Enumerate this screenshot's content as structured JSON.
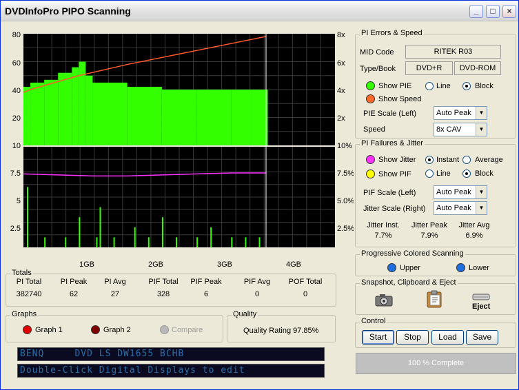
{
  "window": {
    "title": "DVDInfoPro PIPO Scanning",
    "buttons": {
      "minimize": "_",
      "maximize": "□",
      "close": "×"
    }
  },
  "chart_data": [
    {
      "type": "bar",
      "panel": "pi-errors",
      "yleft_ticks": [
        "80",
        "60",
        "40",
        "20",
        "10"
      ],
      "yright_ticks": [
        "8x",
        "6x",
        "4x",
        "2x"
      ],
      "ylim": [
        0,
        80
      ],
      "series": [
        {
          "name": "PIE",
          "kind": "bar",
          "color": "#33ff00",
          "x": [
            0.0,
            0.1,
            0.3,
            0.5,
            0.7,
            0.8,
            0.9,
            1.0,
            1.5,
            2.0,
            2.5,
            3.0,
            3.3,
            3.5
          ],
          "values": [
            42,
            45,
            47,
            52,
            56,
            60,
            50,
            45,
            42,
            40,
            40,
            40,
            40,
            40
          ]
        },
        {
          "name": "Speed",
          "kind": "line",
          "color": "#ff5a2a",
          "x": [
            0.0,
            0.1,
            0.8,
            1.5,
            2.5,
            3.5
          ],
          "values": [
            38,
            40,
            50,
            58,
            68,
            78
          ]
        }
      ],
      "xlim": [
        0,
        4.5
      ]
    },
    {
      "type": "bar",
      "panel": "pi-failures",
      "yleft_ticks": [
        "7.5",
        "5",
        "2.5"
      ],
      "yright_ticks": [
        "10%",
        "7.5%",
        "5.0%",
        "2.5%"
      ],
      "ylim": [
        0,
        10
      ],
      "series": [
        {
          "name": "Jitter",
          "kind": "line",
          "color": "#ff33ff",
          "x": [
            0.0,
            0.5,
            1.0,
            1.5,
            2.0,
            2.5,
            3.0,
            3.5
          ],
          "values": [
            7.3,
            7.2,
            7.1,
            7.1,
            7.2,
            7.3,
            7.4,
            7.4
          ]
        },
        {
          "name": "PIF",
          "kind": "bar",
          "color": "#33ff00",
          "x": [
            0.05,
            0.3,
            0.6,
            0.8,
            1.05,
            1.1,
            1.3,
            1.6,
            1.8,
            2.0,
            2.2,
            2.5,
            2.7,
            3.0,
            3.2,
            3.4
          ],
          "values": [
            6,
            1,
            1,
            3,
            1,
            4,
            1,
            2,
            1,
            3,
            1,
            1,
            2,
            1,
            1,
            1
          ]
        }
      ],
      "xlim": [
        0,
        4.5
      ]
    }
  ],
  "chart_x_ticks": [
    "1GB",
    "2GB",
    "3GB",
    "4GB"
  ],
  "totals": {
    "label": "Totals",
    "headers": [
      "PI Total",
      "PI Peak",
      "PI Avg",
      "PIF Total",
      "PIF Peak",
      "PIF Avg",
      "POF Total"
    ],
    "values": [
      "382740",
      "62",
      "27",
      "328",
      "6",
      "0",
      "0"
    ]
  },
  "graphs": {
    "label": "Graphs",
    "graph1": "Graph 1",
    "graph2": "Graph 2",
    "compare": "Compare"
  },
  "quality": {
    "label": "Quality",
    "text": "Quality Rating 97.85%"
  },
  "lcd": {
    "line1": "BENQ     DVD LS DW1655 BCHB",
    "line2": "Double-Click Digital Displays to edit"
  },
  "pi_errors": {
    "label": "PI Errors & Speed",
    "mid_code_label": "MID Code",
    "mid_code_value": "RITEK   R03",
    "type_label": "Type/Book",
    "type_value": "DVD+R",
    "book_value": "DVD-ROM",
    "show_pie": "Show PIE",
    "show_speed": "Show Speed",
    "line": "Line",
    "block": "Block",
    "pie_scale_label": "PIE Scale (Left)",
    "pie_scale_value": "Auto Peak",
    "speed_label": "Speed",
    "speed_value": "8x CAV"
  },
  "pi_failures": {
    "label": "PI Failures & Jitter",
    "show_jitter": "Show Jitter",
    "instant": "Instant",
    "average": "Average",
    "show_pif": "Show PIF",
    "line": "Line",
    "block": "Block",
    "pif_scale_label": "PIF Scale (Left)",
    "pif_scale_value": "Auto Peak",
    "jitter_scale_label": "Jitter Scale (Right)",
    "jitter_scale_value": "Auto Peak",
    "jitter_inst_label": "Jitter Inst.",
    "jitter_inst_value": "7.7%",
    "jitter_peak_label": "Jitter Peak",
    "jitter_peak_value": "7.9%",
    "jitter_avg_label": "Jitter Avg",
    "jitter_avg_value": "6.9%"
  },
  "progressive": {
    "label": "Progressive Colored Scanning",
    "upper": "Upper",
    "lower": "Lower"
  },
  "snapshot": {
    "label": "Snapshot,  Clipboard  & Eject",
    "eject": "Eject"
  },
  "control": {
    "label": "Control",
    "start": "Start",
    "stop": "Stop",
    "load": "Load",
    "save": "Save"
  },
  "status": {
    "progress_text": "100 % Complete",
    "progress_fraction": 1.0
  },
  "colors": {
    "pie": "#33ff00",
    "speed": "#ff5a2a",
    "jitter": "#ff33ff",
    "pif": "#ffff00",
    "graph1": "#e00000",
    "graph2": "#800000",
    "led_blue": "#1e6fe0"
  }
}
